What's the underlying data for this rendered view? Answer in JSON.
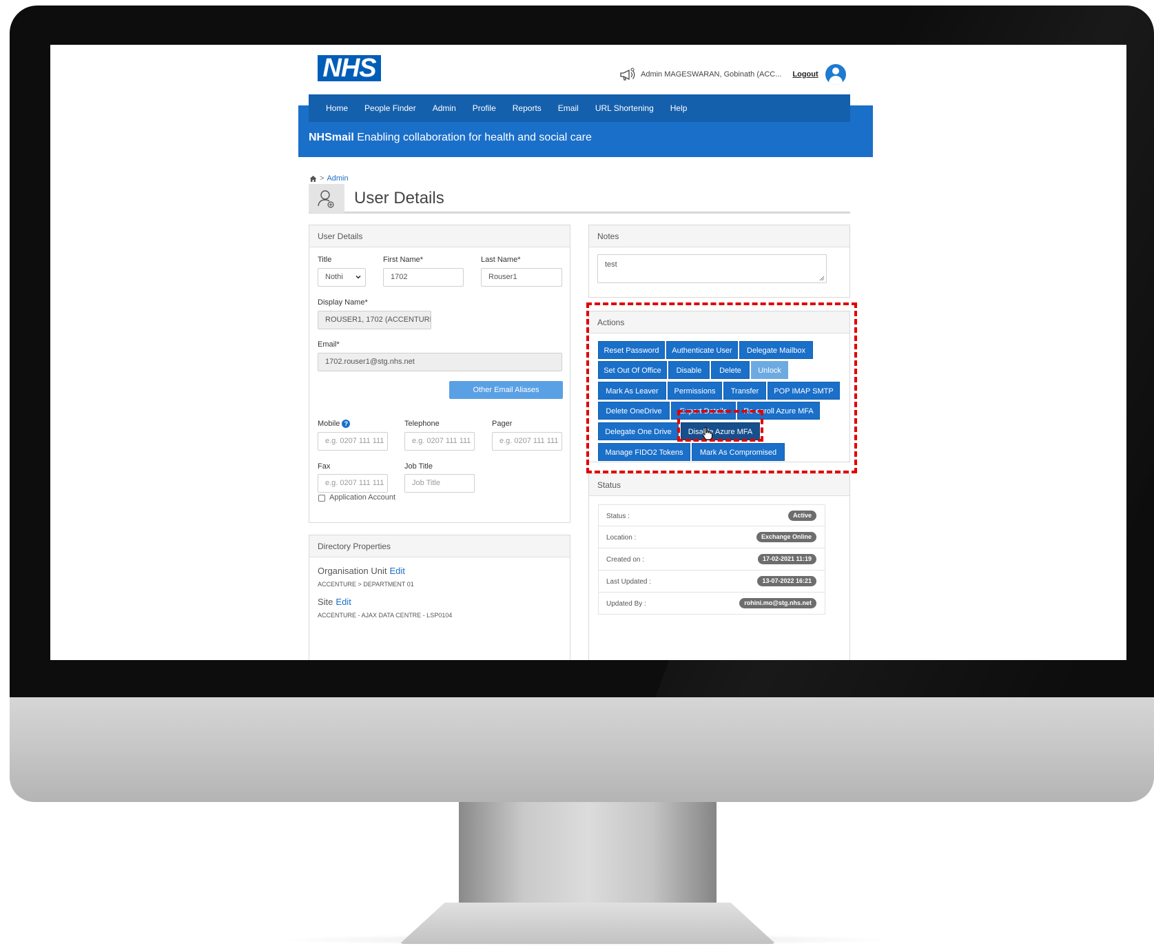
{
  "header": {
    "logo_text": "NHS",
    "user_label": "Admin  MAGESWARAN, Gobinath (ACC...",
    "logout_label": "Logout",
    "icons": {
      "announce": "megaphone-icon",
      "user": "user-avatar-icon"
    }
  },
  "nav": {
    "items": [
      "Home",
      "People Finder",
      "Admin",
      "Profile",
      "Reports",
      "Email",
      "URL Shortening",
      "Help"
    ]
  },
  "banner": {
    "brand": "NHSmail",
    "tagline": " Enabling collaboration for health and social care"
  },
  "breadcrumb": {
    "separator": ">",
    "current": "Admin",
    "icon": "home-icon"
  },
  "page": {
    "title": "User Details",
    "icon": "user-add-icon"
  },
  "user_details": {
    "heading": "User Details",
    "title_label": "Title",
    "title_value": "Nothi",
    "first_name_label": "First Name*",
    "first_name_value": "1702",
    "last_name_label": "Last Name*",
    "last_name_value": "Rouser1",
    "display_name_label": "Display Name*",
    "display_name_value": "ROUSER1, 1702 (ACCENTURE",
    "email_label": "Email*",
    "email_value": "1702.rouser1@stg.nhs.net",
    "other_aliases_button": "Other Email Aliases",
    "mobile_label": "Mobile",
    "mobile_placeholder": "e.g. 0207 111 111",
    "telephone_label": "Telephone",
    "telephone_placeholder": "e.g. 0207 111 111",
    "pager_label": "Pager",
    "pager_placeholder": "e.g. 0207 111 111",
    "fax_label": "Fax",
    "fax_placeholder": "e.g. 0207 111 111",
    "job_title_label": "Job Title",
    "job_title_placeholder": "Job Title",
    "application_account_label": "Application Account",
    "help_icon_glyph": "?"
  },
  "directory": {
    "heading": "Directory Properties",
    "org_unit_label": "Organisation Unit",
    "org_unit_edit": "Edit",
    "org_unit_value": "ACCENTURE > DEPARTMENT 01",
    "site_label": "Site",
    "site_edit": "Edit",
    "site_value": "ACCENTURE - AJAX DATA CENTRE - LSP0104"
  },
  "notes": {
    "heading": "Notes",
    "value": "test"
  },
  "actions": {
    "heading": "Actions",
    "buttons": [
      "Reset Password",
      "Authenticate User",
      "Delegate Mailbox",
      "Set Out Of Office",
      "Disable",
      "Delete",
      "Unlock",
      "Mark As Leaver",
      "Permissions",
      "Transfer",
      "POP IMAP SMTP",
      "Delete OneDrive",
      "Export Details",
      "Re-enroll Azure MFA",
      "Delegate One Drive",
      "Disable Azure MFA",
      "Manage FIDO2 Tokens",
      "Mark As Compromised"
    ],
    "disabled_button": "Unlock",
    "hovered_button": "Disable Azure MFA"
  },
  "status": {
    "heading": "Status",
    "rows": [
      {
        "key": "Status :",
        "value": "Active"
      },
      {
        "key": "Location :",
        "value": "Exchange Online"
      },
      {
        "key": "Created on :",
        "value": "17-02-2021 11:19"
      },
      {
        "key": "Last Updated :",
        "value": "13-07-2022 16:21"
      },
      {
        "key": "Updated By :",
        "value": "rohini.mo@stg.nhs.net"
      }
    ]
  },
  "colors": {
    "nhs_blue": "#005eb8",
    "nav_blue": "#1560ad",
    "banner_blue": "#1a6fc9",
    "highlight_red": "#e00000",
    "badge_grey": "#6d6d6d"
  }
}
